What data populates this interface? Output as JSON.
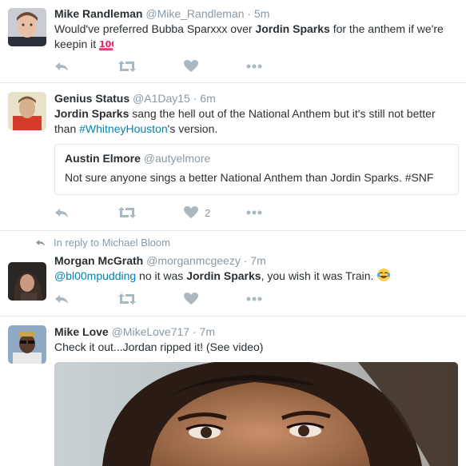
{
  "tweets": [
    {
      "name": "Mike Randleman",
      "handle": "@Mike_Randleman",
      "dot": "·",
      "time": "5m",
      "text": {
        "a": "Would've preferred Bubba Sparxxx over ",
        "b": "Jordin Sparks",
        "c": " for the anthem if we're keepin it "
      },
      "emoji": "hundred-points-emoji"
    },
    {
      "name": "Genius Status",
      "handle": "@A1Day15",
      "dot": "·",
      "time": "6m",
      "text": {
        "a": "Jordin Sparks",
        "b": " sang the hell out of the National Anthem but it's still not better than ",
        "c": "#WhitneyHouston",
        "d": "'s version."
      },
      "quote": {
        "name": "Austin Elmore",
        "handle": "@autyelmore",
        "text": "Not sure anyone sings a better National Anthem than Jordin Sparks. #SNF"
      },
      "like_count": "2"
    },
    {
      "reply_context": "In reply to Michael Bloom",
      "name": "Morgan McGrath",
      "handle": "@morganmcgeezy",
      "dot": "·",
      "time": "7m",
      "text": {
        "a": "@bl00mpudding",
        "b": " no it was ",
        "c": "Jordin Sparks",
        "d": ", you wish it was Train. "
      },
      "emoji": "face-with-tears-of-joy-emoji"
    },
    {
      "name": "Mike Love",
      "handle": "@MikeLove717",
      "dot": "·",
      "time": "7m",
      "text": {
        "a": "Check it out...Jordan ripped it! (See video)"
      },
      "media": "photo-of-woman-face"
    }
  ],
  "colors": {
    "link": "#0084b4",
    "muted": "#8899a6",
    "text": "#292f33",
    "border": "#e1e8ed",
    "action_icon": "#aab8c2"
  }
}
